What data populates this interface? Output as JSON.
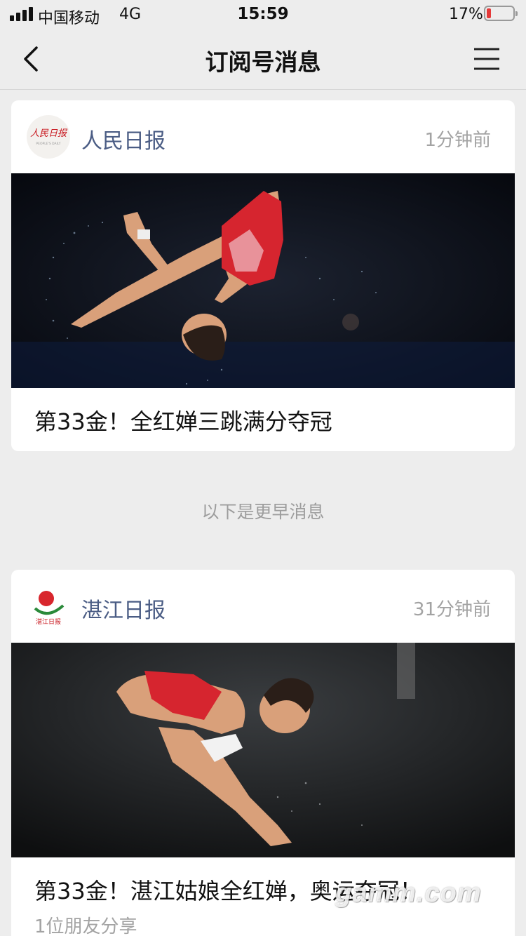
{
  "status_bar": {
    "carrier": "中国移动",
    "network": "4G",
    "time": "15:59",
    "battery_percent": "17%",
    "battery_level": 0.17,
    "battery_color": "#e53a3a"
  },
  "nav": {
    "title": "订阅号消息",
    "back_icon": "chevron-left-icon",
    "menu_icon": "hamburger-menu-icon"
  },
  "messages": [
    {
      "source": "人民日报",
      "logo_text": "人民日报",
      "logo_subtext": "PEOPLE'S DAILY",
      "time_ago": "1分钟前",
      "headline": "第33金！全红婵三跳满分夺冠",
      "image": "diver-midair-photo"
    },
    {
      "source": "湛江日报",
      "logo_text": "湛江日报",
      "time_ago": "31分钟前",
      "headline": "第33金！湛江姑娘全红婵，奥运夺冠！",
      "share_count": "1位朋友分享",
      "image": "diver-tuck-photo"
    }
  ],
  "divider_text": "以下是更早消息",
  "watermark": "gamm.com",
  "colors": {
    "background": "#ededed",
    "source_name": "#4a5c84",
    "muted": "#a3a3a3"
  }
}
